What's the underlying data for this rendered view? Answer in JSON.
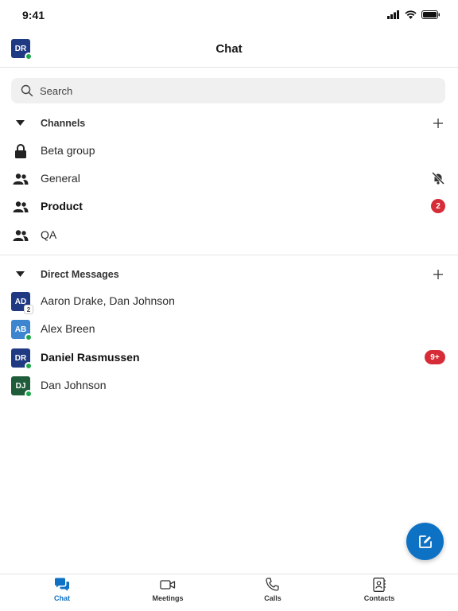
{
  "status_bar": {
    "time": "9:41"
  },
  "header": {
    "title": "Chat",
    "avatar_initials": "DR",
    "avatar_color": "#1f3a82"
  },
  "search": {
    "placeholder": "Search"
  },
  "channels": {
    "title": "Channels",
    "items": [
      {
        "label": "Beta group",
        "icon": "lock-icon",
        "bold": false
      },
      {
        "label": "General",
        "icon": "people-icon",
        "bold": false,
        "muted": true
      },
      {
        "label": "Product",
        "icon": "people-icon",
        "bold": true,
        "unread": "2"
      },
      {
        "label": "QA",
        "icon": "people-icon",
        "bold": false
      }
    ]
  },
  "direct_messages": {
    "title": "Direct Messages",
    "items": [
      {
        "label": "Aaron Drake, Dan Johnson",
        "initials": "AD",
        "color": "#1f3a82",
        "member_count": "2",
        "bold": false
      },
      {
        "label": "Alex Breen",
        "initials": "AB",
        "color": "#3d86cf",
        "bold": false
      },
      {
        "label": "Daniel Rasmussen",
        "initials": "DR",
        "color": "#1f3a82",
        "bold": true,
        "unread": "9+"
      },
      {
        "label": "Dan Johnson",
        "initials": "DJ",
        "color": "#1e5c3a",
        "bold": false
      }
    ]
  },
  "tabs": [
    {
      "label": "Chat",
      "icon": "chat-icon",
      "active": true
    },
    {
      "label": "Meetings",
      "icon": "video-icon",
      "active": false
    },
    {
      "label": "Calls",
      "icon": "phone-icon",
      "active": false
    },
    {
      "label": "Contacts",
      "icon": "contacts-icon",
      "active": false
    }
  ],
  "colors": {
    "accent": "#0e72c4",
    "badge": "#d62c38",
    "presence": "#1ea54a"
  }
}
